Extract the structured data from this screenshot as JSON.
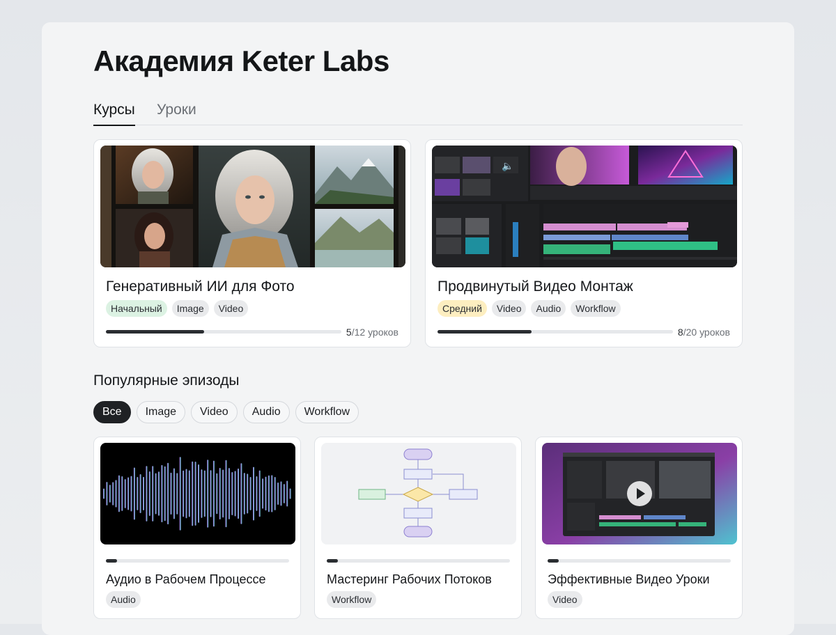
{
  "page": {
    "title": "Академия Keter Labs"
  },
  "tabs": [
    {
      "label": "Курсы",
      "active": true
    },
    {
      "label": "Уроки",
      "active": false
    }
  ],
  "courses": [
    {
      "title": "Генеративный ИИ для Фото",
      "tags": [
        "Начальный",
        "Image",
        "Video"
      ],
      "progress": {
        "done": "5",
        "rest": "/12 уроков",
        "fraction": 0.4167
      }
    },
    {
      "title": "Продвинутый Видео Монтаж",
      "tags": [
        "Средний",
        "Video",
        "Audio",
        "Workflow"
      ],
      "progress": {
        "done": "8",
        "rest": "/20 уроков",
        "fraction": 0.4
      }
    }
  ],
  "popular": {
    "title": "Популярные эпизоды",
    "filters": [
      "Все",
      "Image",
      "Video",
      "Audio",
      "Workflow"
    ],
    "active_filter": "Все"
  },
  "episodes": [
    {
      "title": "Аудио в Рабочем Процессе",
      "tag": "Audio",
      "progress_fraction": 0.06
    },
    {
      "title": "Мастеринг Рабочих Потоков",
      "tag": "Workflow",
      "progress_fraction": 0.06
    },
    {
      "title": "Эффективные Видео Уроки",
      "tag": "Video",
      "progress_fraction": 0.06
    }
  ],
  "colors": {
    "accent_dark": "#1f2124",
    "beginner_tag": "#dcf2e3",
    "intermediate_tag": "#fdeec0",
    "waveform_start": "#a86ae0",
    "waveform_end": "#5fc9c7"
  }
}
